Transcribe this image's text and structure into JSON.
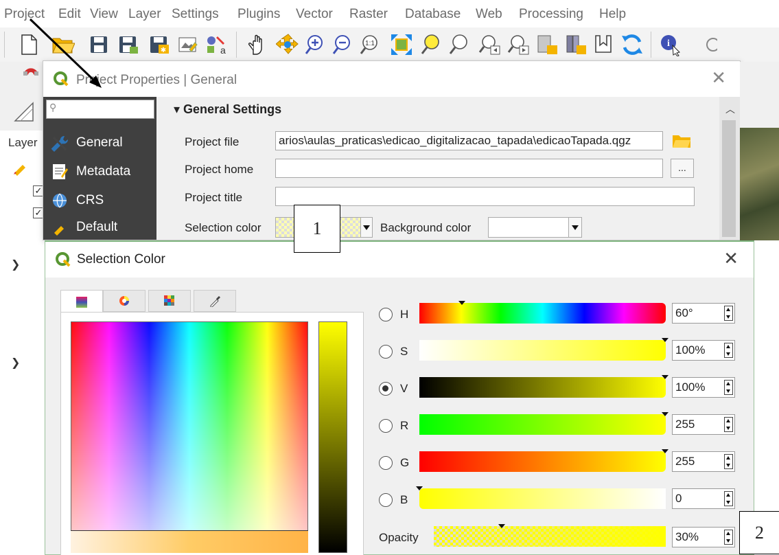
{
  "menubar": {
    "items": [
      "Project",
      "Edit",
      "View",
      "Layer",
      "Settings",
      "Plugins",
      "Vector",
      "Raster",
      "Database",
      "Web",
      "Processing",
      "Help"
    ]
  },
  "layers_panel": {
    "title": "Layer"
  },
  "project_dialog": {
    "title": "Project Properties | General",
    "search_placeholder": "",
    "sidebar": [
      "General",
      "Metadata",
      "CRS",
      "Default"
    ],
    "section": "General Settings",
    "fields": {
      "project_file_label": "Project file",
      "project_file_value": "arios\\aulas_praticas\\edicao_digitalizacao_tapada\\edicaoTapada.qgz",
      "project_home_label": "Project home",
      "project_home_value": "",
      "browse_label": "...",
      "project_title_label": "Project title",
      "project_title_value": "",
      "selection_color_label": "Selection color",
      "background_color_label": "Background color"
    }
  },
  "selection_dialog": {
    "title": "Selection Color",
    "channels": [
      {
        "label": "H",
        "value": "60°",
        "checked": false
      },
      {
        "label": "S",
        "value": "100%",
        "checked": false
      },
      {
        "label": "V",
        "value": "100%",
        "checked": true
      },
      {
        "label": "R",
        "value": "255",
        "checked": false
      },
      {
        "label": "G",
        "value": "255",
        "checked": false
      },
      {
        "label": "B",
        "value": "0",
        "checked": false
      }
    ],
    "opacity_label": "Opacity",
    "opacity_value": "30%",
    "current_color": "#ffff00"
  },
  "callouts": {
    "one": "1",
    "two": "2"
  },
  "icons": [
    "new-icon",
    "open-icon",
    "save-icon",
    "save-as-icon",
    "print-layout-icon",
    "layout-manager-icon",
    "style-manager-icon",
    "pan-icon",
    "pan-to-selection-icon",
    "zoom-in-icon",
    "zoom-out-icon",
    "zoom-native-icon",
    "zoom-full-icon",
    "zoom-to-selection-icon",
    "zoom-to-layer-icon",
    "zoom-last-icon",
    "zoom-next-icon",
    "new-bookmark-icon",
    "show-bookmarks-icon",
    "temporary-scratch-icon",
    "refresh-icon",
    "identify-icon"
  ]
}
